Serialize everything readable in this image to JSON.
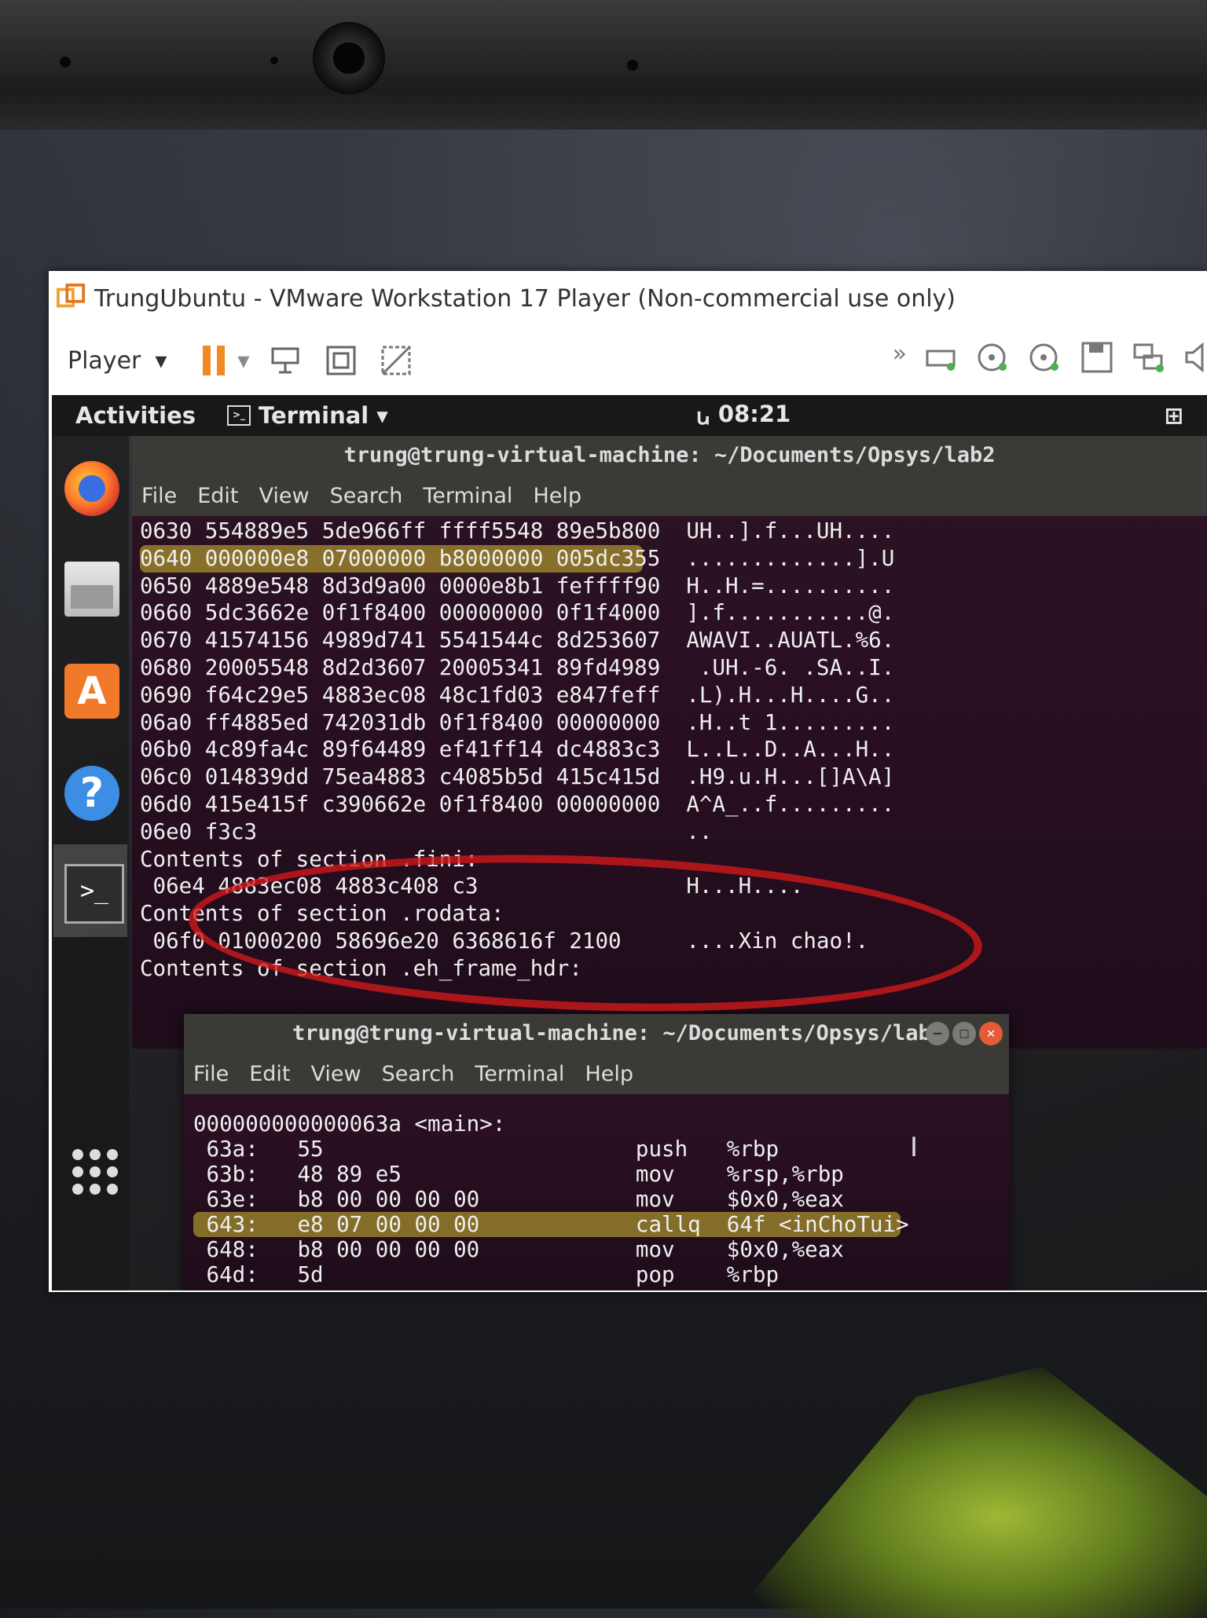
{
  "vmware": {
    "title": "TrungUbuntu - VMware Workstation 17 Player (Non-commercial use only)",
    "player_label": "Player",
    "icons": [
      "vmware-logo-icon",
      "pause-icon",
      "send-ctrl-alt-del-icon",
      "fullscreen-icon",
      "unity-icon",
      "forward-icon",
      "removable-device-icon",
      "cd-icon",
      "floppy-icon",
      "network-icon",
      "sound-icon"
    ]
  },
  "ubuntu": {
    "activities": "Activities",
    "app_menu": "Terminal",
    "clock": "08:21",
    "dock": [
      "firefox-icon",
      "files-icon",
      "software-icon",
      "help-icon",
      "terminal-icon",
      "apps-grid-icon"
    ]
  },
  "term1": {
    "title": "trung@trung-virtual-machine: ~/Documents/Opsys/lab2",
    "menu": [
      "File",
      "Edit",
      "View",
      "Search",
      "Terminal",
      "Help"
    ],
    "lines": [
      "0630 554889e5 5de966ff ffff5548 89e5b800  UH..].f...UH....",
      "0640 000000e8 07000000 b8000000 005dc355  .............].U",
      "0650 4889e548 8d3d9a00 0000e8b1 feffff90  H..H.=..........",
      "0660 5dc3662e 0f1f8400 00000000 0f1f4000  ].f...........@.",
      "0670 41574156 4989d741 5541544c 8d253607  AWAVI..AUATL.%6.",
      "0680 20005548 8d2d3607 20005341 89fd4989   .UH.-6. .SA..I.",
      "0690 f64c29e5 4883ec08 48c1fd03 e847feff  .L).H...H....G..",
      "06a0 ff4885ed 742031db 0f1f8400 00000000  .H..t 1.........",
      "06b0 4c89fa4c 89f64489 ef41ff14 dc4883c3  L..L..D..A...H..",
      "06c0 014839dd 75ea4883 c4085b5d 415c415d  .H9.u.H...[]A\\A]",
      "06d0 415e415f c390662e 0f1f8400 00000000  A^A_..f.........",
      "06e0 f3c3                                 ..",
      "Contents of section .fini:",
      " 06e4 4883ec08 4883c408 c3                H...H....",
      "Contents of section .rodata:",
      " 06f0 01000200 58696e20 6368616f 2100     ....Xin chao!.",
      "Contents of section .eh_frame_hdr:"
    ]
  },
  "term2": {
    "title": "trung@trung-virtual-machine: ~/Documents/Opsys/lab2",
    "menu": [
      "File",
      "Edit",
      "View",
      "Search",
      "Terminal",
      "Help"
    ],
    "lines": [
      "000000000000063a <main>:",
      " 63a:   55                        push   %rbp",
      " 63b:   48 89 e5                  mov    %rsp,%rbp",
      " 63e:   b8 00 00 00 00            mov    $0x0,%eax",
      " 643:   e8 07 00 00 00            callq  64f <inChoTui>",
      " 648:   b8 00 00 00 00            mov    $0x0,%eax",
      " 64d:   5d                        pop    %rbp"
    ]
  }
}
